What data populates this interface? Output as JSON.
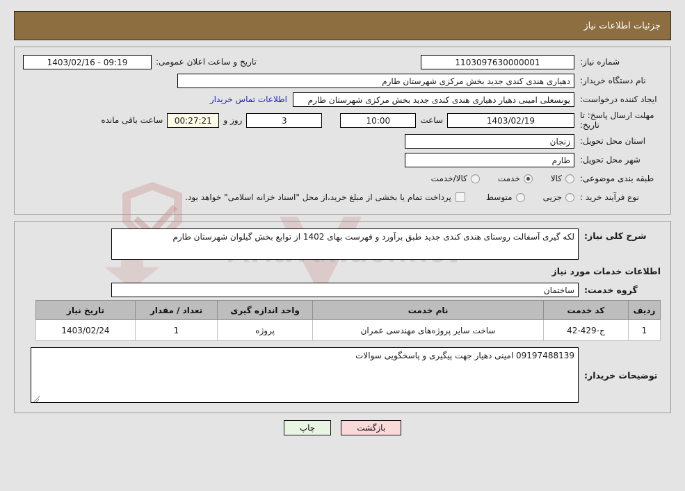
{
  "header": {
    "title": "جزئیات اطلاعات نیاز"
  },
  "form": {
    "need_number": {
      "label": "شماره نیاز:",
      "value": "1103097630000001"
    },
    "announce_datetime": {
      "label": "تاریخ و ساعت اعلان عمومی:",
      "value": "09:19 - 1403/02/16"
    },
    "buyer_org": {
      "label": "نام دستگاه خریدار:",
      "value": "دهیاری هندی کندی جدید بخش مرکزی شهرستان طارم"
    },
    "request_creator": {
      "label": "ایجاد کننده درخواست:",
      "value": "یونسعلی امینی دهیار دهیاری هندی کندی جدید بخش مرکزی شهرستان طارم"
    },
    "buyer_contact_link": "اطلاعات تماس خریدار",
    "deadline": {
      "label_line1": "مهلت ارسال پاسخ: تا",
      "label_line2": "تاریخ:",
      "date": "1403/02/19",
      "hour_label": "ساعت",
      "hour": "10:00",
      "days": "3",
      "days_suffix": "روز و",
      "countdown": "00:27:21",
      "countdown_suffix": "ساعت باقی مانده"
    },
    "delivery_province": {
      "label": "استان محل تحویل:",
      "value": "زنجان"
    },
    "delivery_city": {
      "label": "شهر محل تحویل:",
      "value": "طارم"
    },
    "subject_category": {
      "label": "طبقه بندی موضوعی:",
      "options": [
        "کالا",
        "خدمت",
        "کالا/خدمت"
      ],
      "selected": "خدمت"
    },
    "purchase_process": {
      "label": "نوع فرآیند خرید :",
      "options": [
        "جزیی",
        "متوسط"
      ],
      "selected": ""
    },
    "treasury_checkbox": {
      "checked": false,
      "text": "پرداخت تمام یا بخشی از مبلغ خرید،از محل \"اسناد خزانه اسلامی\" خواهد بود."
    }
  },
  "summary": {
    "label": "شرح کلی نیاز:",
    "value": "لکه گیری آسفالت روستای هندی کندی جدید طبق برآورد و فهرست بهای 1402 از توابع بخش گیلوان شهرستان طارم"
  },
  "services_section": {
    "title": "اطلاعات خدمات مورد نیاز",
    "service_group": {
      "label": "گروه خدمت:",
      "value": "ساختمان"
    }
  },
  "table": {
    "columns": [
      "ردیف",
      "کد خدمت",
      "نام خدمت",
      "واحد اندازه گیری",
      "تعداد / مقدار",
      "تاریخ نیاز"
    ],
    "rows": [
      {
        "row": "1",
        "code": "ج-429-42",
        "name": "ساخت سایر پروژه‌های مهندسی عمران",
        "unit": "پروژه",
        "qty": "1",
        "date": "1403/02/24"
      }
    ]
  },
  "buyer_notes": {
    "label": "توضیحات خریدار:",
    "value": "09197488139 امینی دهیار جهت پیگیری و پاسخگویی سوالات"
  },
  "footer": {
    "print_label": "چاپ",
    "back_label": "بازگشت"
  },
  "watermark": {
    "text": "AriaTender.net"
  },
  "colors": {
    "header_bg": "#8d6e41",
    "link": "#2222cc",
    "countdown_bg": "#fbfbe8",
    "print_btn_bg": "#e8f5e3",
    "back_btn_bg": "#fbd9d9",
    "table_header_bg": "#bdbdbd",
    "page_bg": "#e4e4e4"
  }
}
